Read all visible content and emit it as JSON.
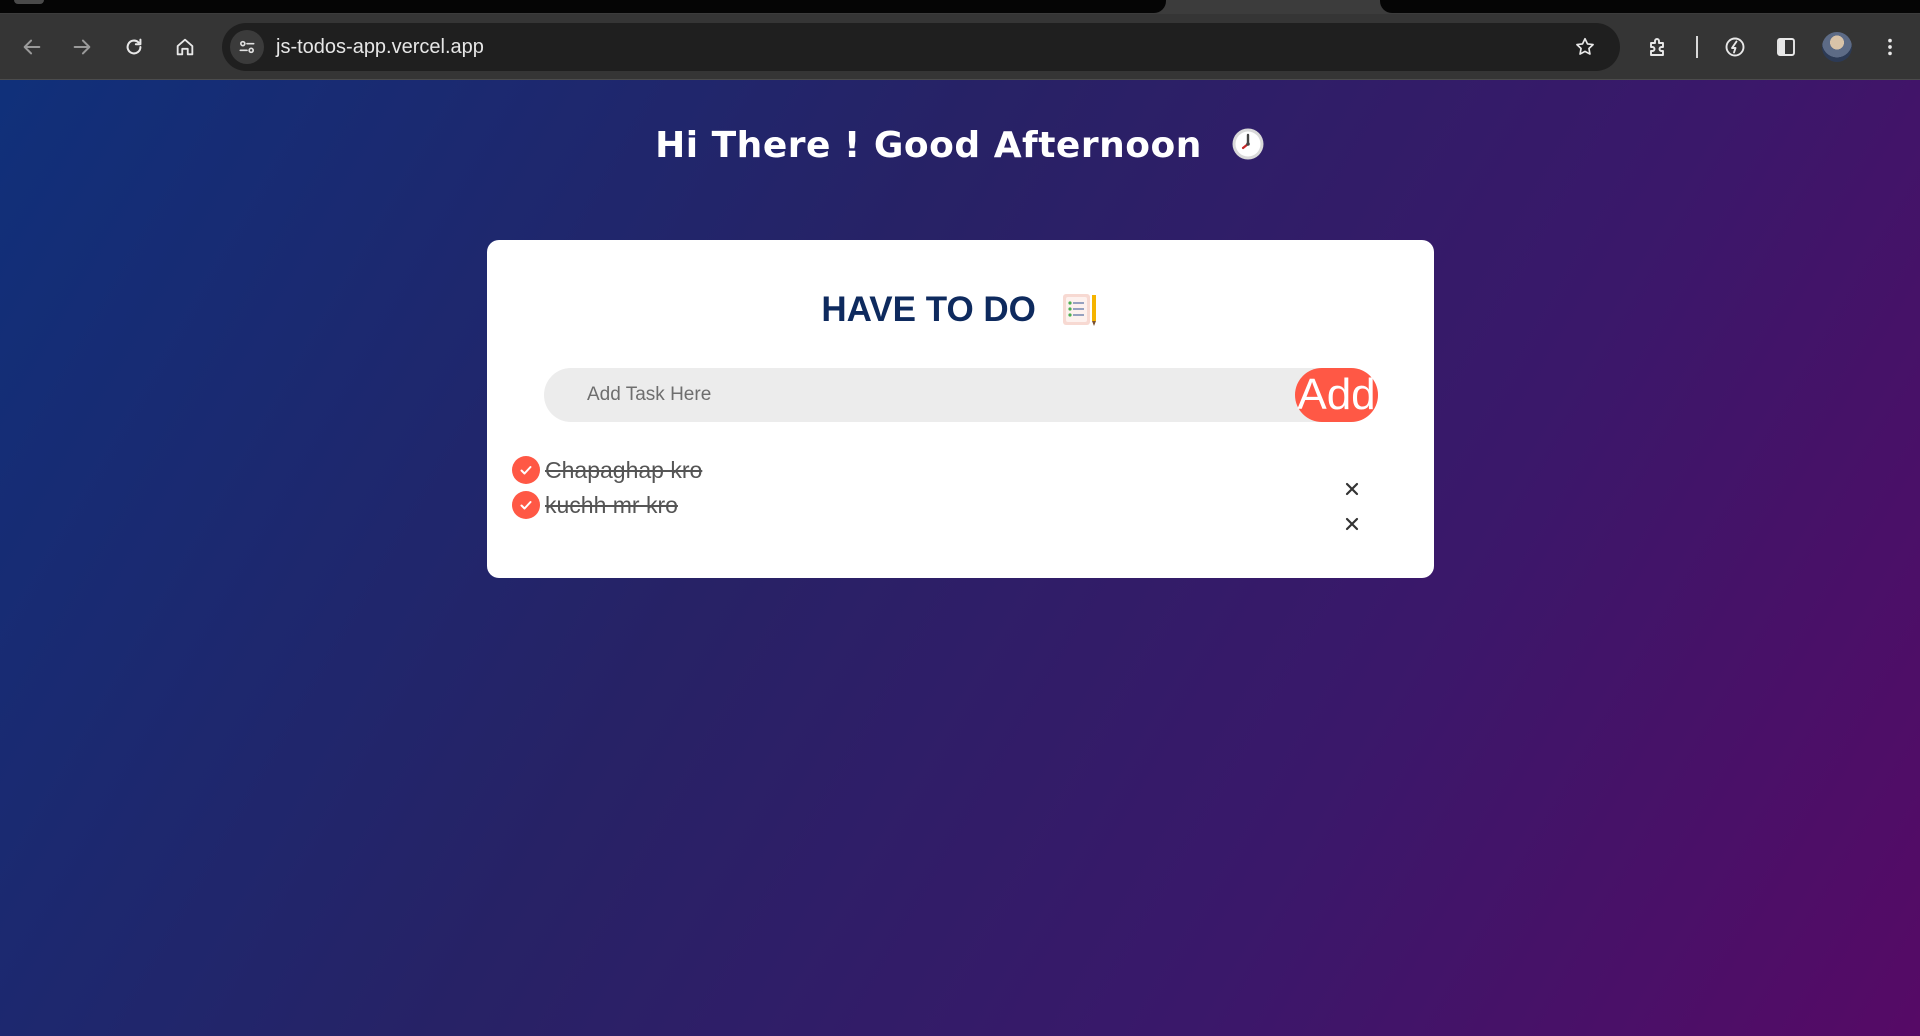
{
  "browser": {
    "url": "js-todos-app.vercel.app",
    "icons": [
      "back-arrow-icon",
      "forward-arrow-icon",
      "reload-icon",
      "home-icon",
      "site-info-icon",
      "bookmark-star-icon",
      "extensions-puzzle-icon",
      "performance-icon",
      "side-panel-icon",
      "profile-avatar",
      "kebab-menu-icon"
    ]
  },
  "page": {
    "greeting": "Hi There ! Good Afternoon",
    "greeting_icon": "clock-emoji",
    "background_gradient": [
      "#10307a",
      "#272266",
      "#3a186a",
      "#560a66"
    ]
  },
  "todo": {
    "title": "HAVE TO DO",
    "title_icon": "notepad-emoji",
    "input_placeholder": "Add Task Here",
    "input_value": "",
    "add_label": "Add",
    "accent_color": "#ff5845",
    "title_color": "#0e2a5e",
    "tasks": [
      {
        "text": "Chapaghap kro",
        "completed": true
      },
      {
        "text": "kuchh mr kro",
        "completed": true
      }
    ],
    "delete_label": "×"
  }
}
